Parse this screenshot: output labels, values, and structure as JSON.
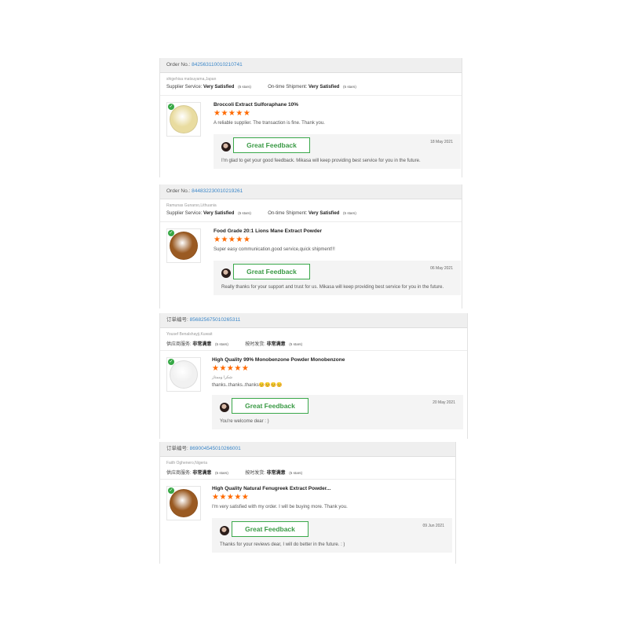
{
  "reviews": [
    {
      "order_label": "Order No.: ",
      "order_no": "842563110010210741",
      "buyer": "shigehisa matsuyama,Japan",
      "supplier_label": "Supplier Service:",
      "supplier_value": "Very Satisfied",
      "supplier_stars": "(5 stars)",
      "shipment_label": "On-time Shipment:",
      "shipment_value": "Very Satisfied",
      "shipment_stars": "(5 stars)",
      "product": "Broccoli Extract Sulforaphane 10%",
      "product_color": "#e9dca0",
      "rating": "★★★★★",
      "comment": "A reliable supplier. The transaction is fine. Thank you.",
      "comment2": "",
      "badge": "Great Feedback",
      "reply_date": "18 May 2021",
      "reply": "I'm glad to get your good feedback. Mikasa will keep providing best service for you in the future."
    },
    {
      "order_label": "Order No.: ",
      "order_no": "844832230010219261",
      "buyer": "Ramunas Gunarso,Lithuania",
      "supplier_label": "Supplier Service:",
      "supplier_value": "Very Satisfied",
      "supplier_stars": "(5 stars)",
      "shipment_label": "On-time Shipment:",
      "shipment_value": "Very Satisfied",
      "shipment_stars": "(5 stars)",
      "product": "Food Grade 20:1 Lions Mane Extract Powder",
      "product_color": "#9a5a22",
      "rating": "★★★★★",
      "comment": "Super easy communication,good service,quick shipment!!!",
      "comment2": "",
      "badge": "Great Feedback",
      "reply_date": "06 May 2021",
      "reply": "Really thanks for your support and trust for us. Mikasa will keep providing best service for you in the future."
    },
    {
      "order_label": "订单编号: ",
      "order_no": "856825675010265311",
      "buyer": "Yousef Benalshayji,Kuwait",
      "supplier_label": "供应商服务:",
      "supplier_value": "非常满意",
      "supplier_stars": "(5 stars)",
      "shipment_label": "按时发货:",
      "shipment_value": "非常满意",
      "shipment_stars": "(5 stars)",
      "product": "High Quality 99% Monobenzone Powder Monobenzone",
      "product_color": "#f1f1f1",
      "rating": "★★★★★",
      "comment": "شكرا وممتاز",
      "comment2": "thanks..thanks..thanks😊😊😊😊",
      "badge": "Great Feedback",
      "reply_date": "20 May 2021",
      "reply": "You're welcome dear : )"
    },
    {
      "order_label": "订单编号: ",
      "order_no": "869004545010266001",
      "buyer": "Faith Oghenero,Nigeria",
      "supplier_label": "供应商服务:",
      "supplier_value": "非常满意",
      "supplier_stars": "(5 stars)",
      "shipment_label": "按时发货:",
      "shipment_value": "非常满意",
      "shipment_stars": "(5 stars)",
      "product": "High Quality Natural Fenugreek Extract Powder...",
      "product_color": "#9a5a22",
      "rating": "★★★★★",
      "comment": "I'm very satisfied with my order. I will be buying more. Thank you.",
      "comment2": "",
      "badge": "Great Feedback",
      "reply_date": "09 Jun 2021",
      "reply": "Thanks for your reviews dear, I will do better in the future. : )"
    }
  ]
}
